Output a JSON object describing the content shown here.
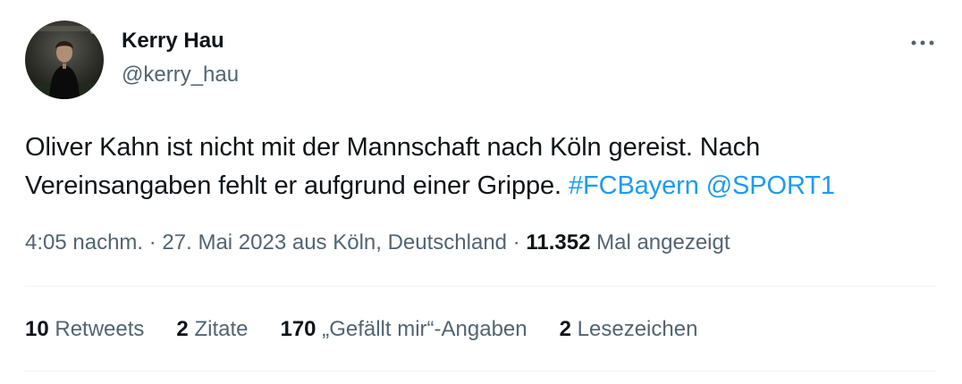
{
  "author": {
    "display_name": "Kerry Hau",
    "handle": "@kerry_hau",
    "avatar_icon": "profile-photo"
  },
  "menu": {
    "icon": "more-horizontal-icon"
  },
  "tweet": {
    "text_line1": "Oliver Kahn ist nicht mit der Mannschaft nach Köln gereist. Nach",
    "text_line2": "Vereinsangaben fehlt er aufgrund einer Grippe.",
    "hashtag": "#FCBayern",
    "mention": "@SPORT1",
    "link_color": "#1d9bf0"
  },
  "meta": {
    "time": "4:05 nachm.",
    "sep1": " · ",
    "date": "27. Mai 2023",
    "location": " aus Köln, Deutschland",
    "sep2": " · ",
    "views_count": "11.352",
    "views_label": " Mal angezeigt"
  },
  "stats": {
    "retweets_count": "10",
    "retweets_label": " Retweets",
    "quotes_count": "2",
    "quotes_label": " Zitate",
    "likes_count": "170",
    "likes_label": " „Gefällt mir“-Angaben",
    "bookmarks_count": "2",
    "bookmarks_label": " Lesezeichen"
  }
}
